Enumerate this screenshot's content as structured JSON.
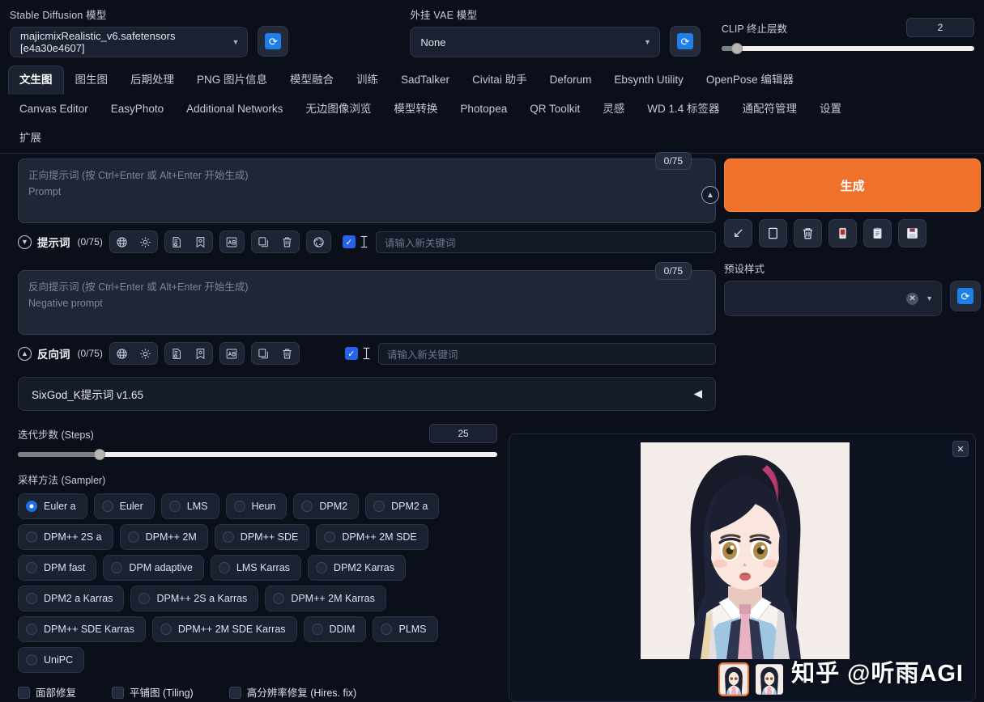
{
  "topbar": {
    "model_label": "Stable Diffusion 模型",
    "model_value": "majicmixRealistic_v6.safetensors [e4a30e4607]",
    "vae_label": "外挂 VAE 模型",
    "vae_value": "None",
    "clip_label": "CLIP 终止层数",
    "clip_value": "2",
    "clip_slider_percent": 6,
    "refresh_icon": "refresh-icon",
    "accent_blue": "#1f7fe8"
  },
  "tabs": {
    "row1": [
      "文生图",
      "图生图",
      "后期处理",
      "PNG 图片信息",
      "模型融合",
      "训练",
      "SadTalker",
      "Civitai 助手",
      "Deforum",
      "Ebsynth Utility",
      "OpenPose 编辑器"
    ],
    "row2": [
      "Canvas Editor",
      "EasyPhoto",
      "Additional Networks",
      "无边图像浏览",
      "模型转换",
      "Photopea",
      "QR Toolkit",
      "灵感",
      "WD 1.4 标签器",
      "通配符管理",
      "设置"
    ],
    "row3": [
      "扩展"
    ],
    "active": "文生图"
  },
  "prompt": {
    "count_badge": "0/75",
    "placeholder_cn": "正向提示词 (按 Ctrl+Enter 或 Alt+Enter 开始生成)",
    "placeholder_en": "Prompt",
    "title": "提示词",
    "count": "(0/75)",
    "keyword_placeholder": "请输入新关键词",
    "icons": [
      "globe-icon",
      "gear-icon",
      "document-search-icon",
      "bookmark-star-icon",
      "translate-ab-icon",
      "copy-icon",
      "trash-icon",
      "spiral-icon"
    ]
  },
  "negative": {
    "count_badge": "0/75",
    "placeholder_cn": "反向提示词 (按 Ctrl+Enter 或 Alt+Enter 开始生成)",
    "placeholder_en": "Negative prompt",
    "title": "反向词",
    "count": "(0/75)",
    "keyword_placeholder": "请输入新关键词",
    "icons": [
      "globe-icon",
      "gear-icon",
      "document-search-icon",
      "bookmark-star-icon",
      "translate-ab-icon",
      "copy-icon",
      "trash-icon"
    ]
  },
  "sixgod": {
    "label": "SixGod_K提示词 v1.65",
    "arrow": "◀"
  },
  "steps": {
    "label": "迭代步数 (Steps)",
    "value": "25",
    "percent": 17
  },
  "sampler": {
    "label": "采样方法 (Sampler)",
    "selected": "Euler a",
    "options": [
      "Euler a",
      "Euler",
      "LMS",
      "Heun",
      "DPM2",
      "DPM2 a",
      "DPM++ 2S a",
      "DPM++ 2M",
      "DPM++ SDE",
      "DPM++ 2M SDE",
      "DPM fast",
      "DPM adaptive",
      "LMS Karras",
      "DPM2 Karras",
      "DPM2 a Karras",
      "DPM++ 2S a Karras",
      "DPM++ 2M Karras",
      "DPM++ SDE Karras",
      "DPM++ 2M SDE Karras",
      "DDIM",
      "PLMS",
      "UniPC"
    ]
  },
  "bottom_checks": [
    "面部修复",
    "平铺图 (Tiling)",
    "高分辨率修复 (Hires. fix)"
  ],
  "right": {
    "generate_label": "生成",
    "generate_color": "#f0712a",
    "action_icons": [
      "arrow-down-left-icon",
      "blank-square-icon",
      "trash-icon",
      "card-icon",
      "clipboard-icon",
      "floppy-save-icon"
    ],
    "styles_label": "预设样式",
    "styles_value": "",
    "clear_icon": "clear-x-icon",
    "dropdown_icon": "chevron-down-icon",
    "refresh_icon": "refresh-icon"
  },
  "gallery": {
    "close_icon": "close-icon",
    "watermark": "知乎 @听雨AGI",
    "thumbnail_count": 2,
    "selected_thumbnail": 1
  }
}
